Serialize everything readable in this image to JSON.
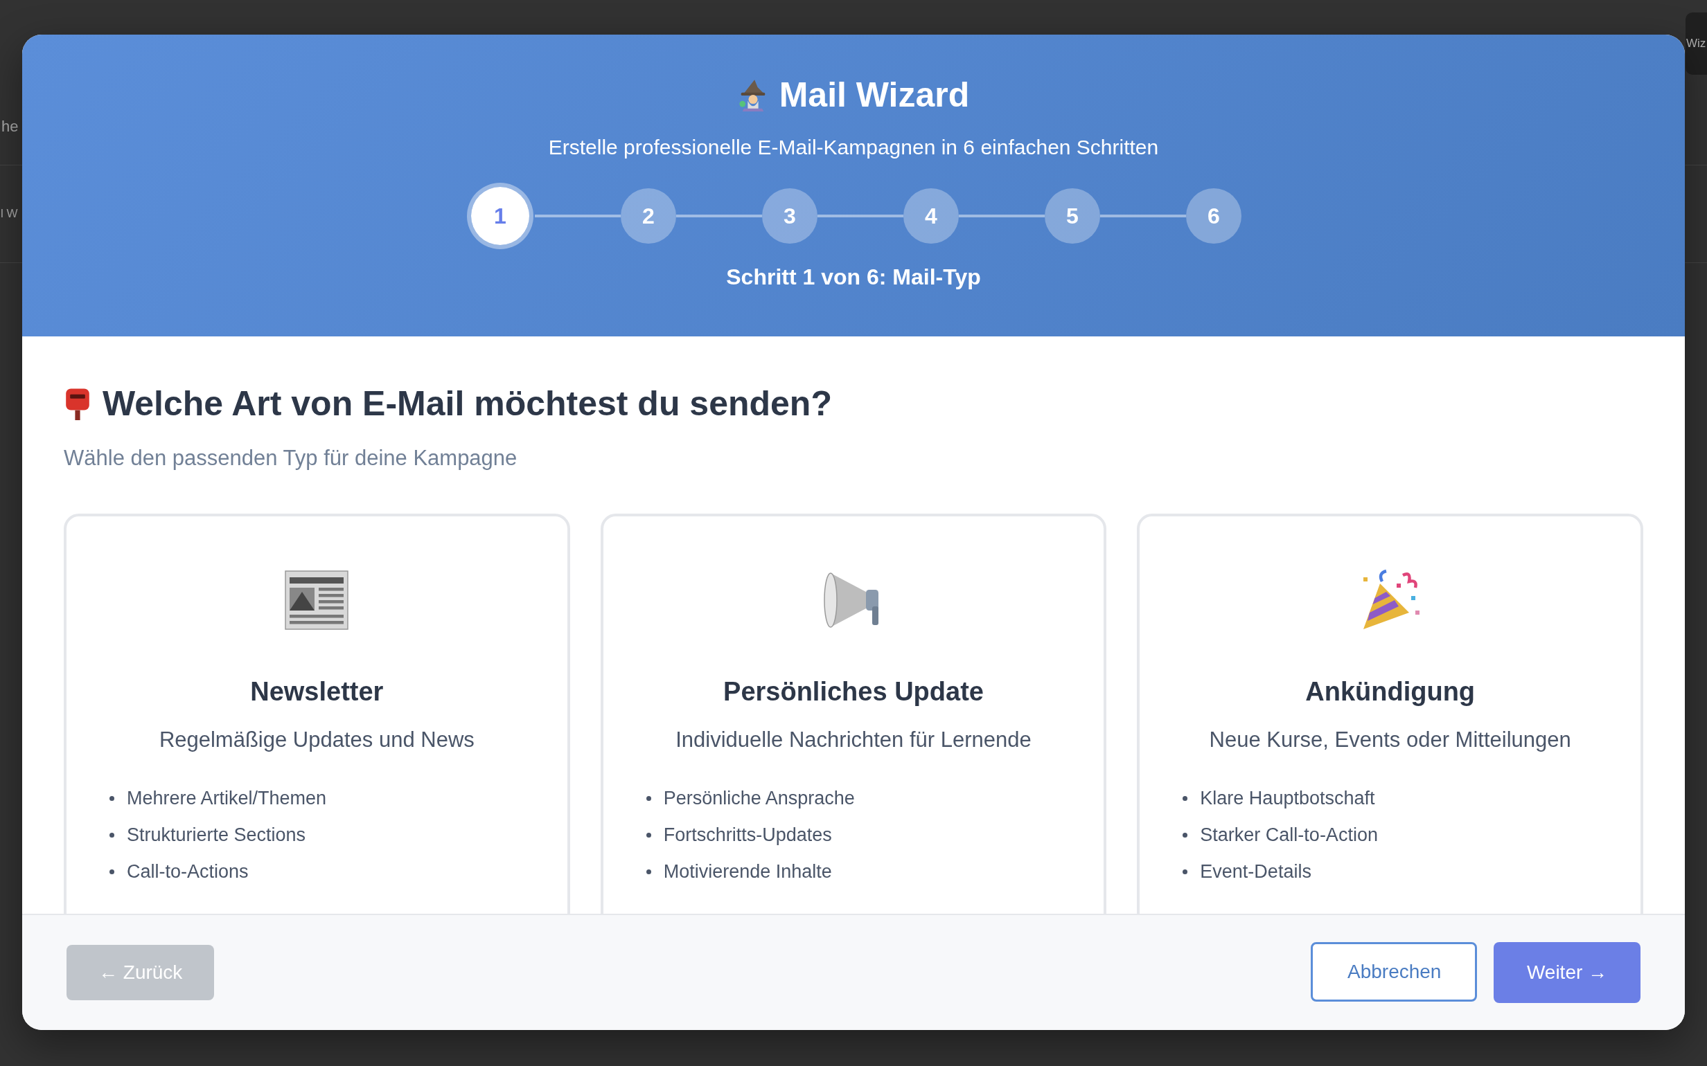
{
  "background": {
    "fragments": [
      "he",
      "l W"
    ],
    "button": "Wiz"
  },
  "modal": {
    "title": "Mail Wizard",
    "subtitle": "Erstelle professionelle E-Mail-Kampagnen in 6 einfachen Schritten",
    "steps": [
      {
        "label": "1",
        "selected": true
      },
      {
        "label": "2",
        "selected": false
      },
      {
        "label": "3",
        "selected": false
      },
      {
        "label": "4",
        "selected": false
      },
      {
        "label": "5",
        "selected": false
      },
      {
        "label": "6",
        "selected": false
      }
    ],
    "step_caption": "Schritt 1 von 6: Mail-Typ"
  },
  "question": {
    "title": "Welche Art von E-Mail möchtest du senden?",
    "hint": "Wähle den passenden Typ für deine Kampagne"
  },
  "options": [
    {
      "kind": "newsletter",
      "title": "Newsletter",
      "description": "Regelmäßige Updates und News",
      "features": [
        "Mehrere Artikel/Themen",
        "Strukturierte Sections",
        "Call-to-Actions"
      ]
    },
    {
      "kind": "personal",
      "title": "Persönliches Update",
      "description": "Individuelle Nachrichten für Lernende",
      "features": [
        "Persönliche Ansprache",
        "Fortschritts-Updates",
        "Motivierende Inhalte"
      ]
    },
    {
      "kind": "announcement",
      "title": "Ankündigung",
      "description": "Neue Kurse, Events oder Mitteilungen",
      "features": [
        "Klare Hauptbotschaft",
        "Starker Call-to-Action",
        "Event-Details"
      ]
    }
  ],
  "footer": {
    "back": {
      "label": "← Zurück",
      "disabled": true
    },
    "cancel": "Abbrechen",
    "next": "Weiter →"
  }
}
